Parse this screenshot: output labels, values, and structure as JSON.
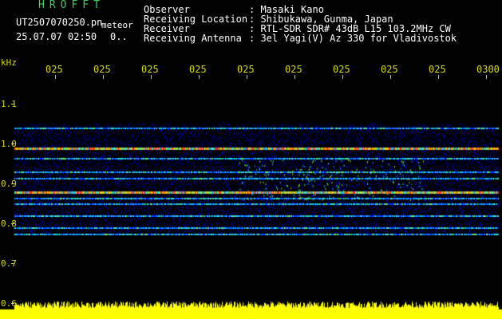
{
  "header": {
    "logo": "HROFFT",
    "filename": "UT2507070250.pn",
    "meteor_label": "meteor",
    "timestamp": "25.07.07 02:50",
    "extra_value": "0.."
  },
  "metadata": {
    "rows": [
      {
        "label": "Observer",
        "value": ": Masaki Kano"
      },
      {
        "label": "Receiving Location",
        "value": ": Shibukawa, Gunma, Japan"
      },
      {
        "label": "Receiver",
        "value": ": RTL-SDR SDR# 43dB L15 103.2MHz CW"
      },
      {
        "label": "Receiving Antenna",
        "value": ": 3el Yagi(V) Az 330 for Vladivostok"
      }
    ]
  },
  "chart_data": {
    "type": "heatmap",
    "ylabel": "kHz",
    "x_ticks": [
      "025",
      "025",
      "025",
      "025",
      "025",
      "025",
      "025",
      "025",
      "025",
      "0300"
    ],
    "y_ticks": [
      "1.1",
      "1.0",
      "0.9",
      "0.8",
      "0.7",
      "0.6"
    ],
    "ylim": [
      0.6,
      1.1
    ],
    "signal_lines_khz": [
      1.04,
      0.99,
      0.965,
      0.93,
      0.915,
      0.88,
      0.865,
      0.85,
      0.82,
      0.79,
      0.775
    ],
    "colors": {
      "axis": "#d8d820",
      "amplitude_band": "#ffff00",
      "background": "#000000"
    }
  }
}
